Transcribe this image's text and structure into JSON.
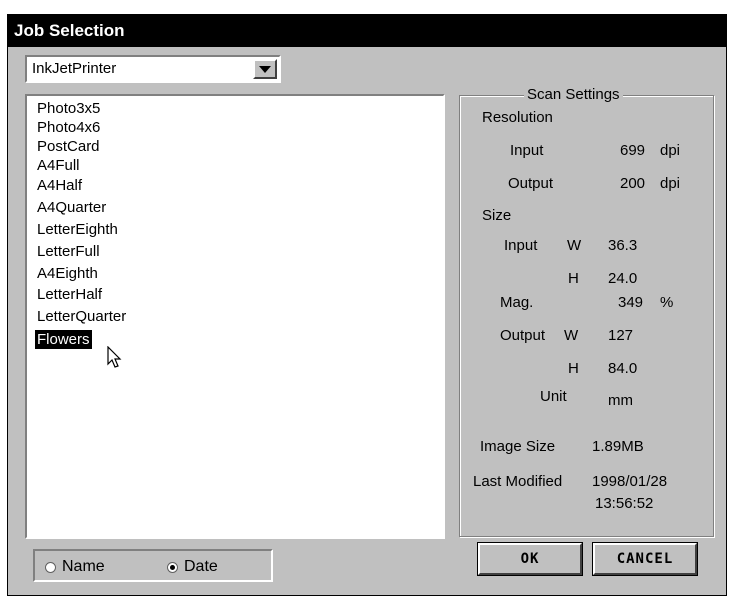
{
  "window": {
    "title": "Job Selection"
  },
  "printer_select": {
    "value": "InkJetPrinter"
  },
  "job_list": {
    "items": [
      "Photo3x5",
      "Photo4x6",
      "PostCard",
      "A4Full",
      "A4Half",
      "A4Quarter",
      "LetterEighth",
      "LetterFull",
      "A4Eighth",
      "LetterHalf",
      "LetterQuarter",
      "Flowers"
    ],
    "selected": "Flowers"
  },
  "scan_settings": {
    "title": "Scan Settings",
    "resolution_label": "Resolution",
    "res_input_label": "Input",
    "res_input_value": "699",
    "res_input_unit": "dpi",
    "res_output_label": "Output",
    "res_output_value": "200",
    "res_output_unit": "dpi",
    "size_label": "Size",
    "size_input_label": "Input",
    "w_label": "W",
    "h_label": "H",
    "input_w": "36.3",
    "input_h": "24.0",
    "mag_label": "Mag.",
    "mag_value": "349",
    "mag_unit": "%",
    "size_output_label": "Output",
    "output_w": "127",
    "output_h": "84.0",
    "unit_label": "Unit",
    "unit_value": "mm",
    "image_size_label": "Image Size",
    "image_size_value": "1.89MB",
    "last_modified_label": "Last Modified",
    "last_modified_date": "1998/01/28",
    "last_modified_time": "13:56:52"
  },
  "sort": {
    "name_label": "Name",
    "date_label": "Date",
    "selected": "Date"
  },
  "buttons": {
    "ok": "OK",
    "cancel": "CANCEL"
  }
}
